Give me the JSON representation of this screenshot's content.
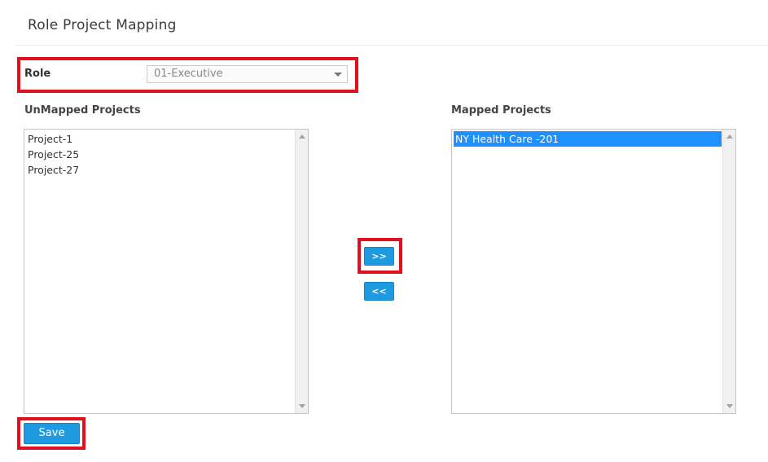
{
  "page": {
    "title": "Role Project Mapping"
  },
  "role": {
    "label": "Role",
    "selected_value": "01-Executive"
  },
  "unmapped": {
    "label": "UnMapped Projects",
    "items": [
      "Project-1",
      "Project-25",
      "Project-27"
    ]
  },
  "mapped": {
    "label": "Mapped Projects",
    "items": [
      "NY Health Care -201"
    ],
    "selected_index": 0
  },
  "actions": {
    "move_right_label": ">>",
    "move_left_label": "<<",
    "save_label": "Save"
  },
  "colors": {
    "accent": "#1e9be0",
    "highlight": "#e0101e",
    "selection": "#1e90ff"
  },
  "icons": {
    "role_dropdown": "chevron-down-icon",
    "scroll_up": "scroll-up-arrow-icon",
    "scroll_down": "scroll-down-arrow-icon"
  }
}
